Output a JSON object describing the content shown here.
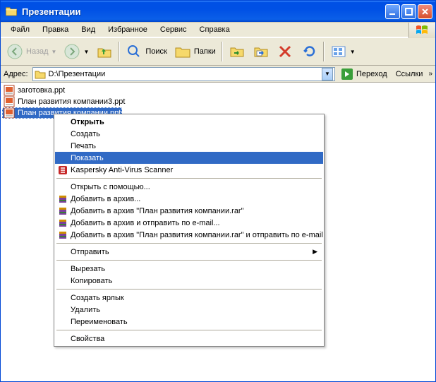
{
  "window": {
    "title": "Презентации"
  },
  "menubar": {
    "file": "Файл",
    "edit": "Правка",
    "view": "Вид",
    "favorites": "Избранное",
    "tools": "Сервис",
    "help": "Справка"
  },
  "toolbar": {
    "back": "Назад",
    "search": "Поиск",
    "folders": "Папки"
  },
  "addressbar": {
    "label": "Адрес:",
    "path": "D:\\Презентации",
    "go": "Переход",
    "links": "Ссылки"
  },
  "files": [
    {
      "name": "заготовка.ppt",
      "selected": false
    },
    {
      "name": "План развития компании3.ppt",
      "selected": false
    },
    {
      "name": "План развития компании.ppt",
      "selected": true
    }
  ],
  "contextmenu": {
    "open": "Открыть",
    "new": "Создать",
    "print": "Печать",
    "show": "Показать",
    "kaspersky": "Kaspersky Anti-Virus Scanner",
    "openwith": "Открыть с помощью...",
    "addarchive": "Добавить в архив...",
    "addarchive_named": "Добавить в архив \"План развития компании.rar\"",
    "addarchive_email": "Добавить в архив и отправить по e-mail...",
    "addarchive_named_email": "Добавить в архив \"План развития компании.rar\" и отправить по e-mail",
    "sendto": "Отправить",
    "cut": "Вырезать",
    "copy": "Копировать",
    "shortcut": "Создать ярлык",
    "delete": "Удалить",
    "rename": "Переименовать",
    "properties": "Свойства"
  }
}
